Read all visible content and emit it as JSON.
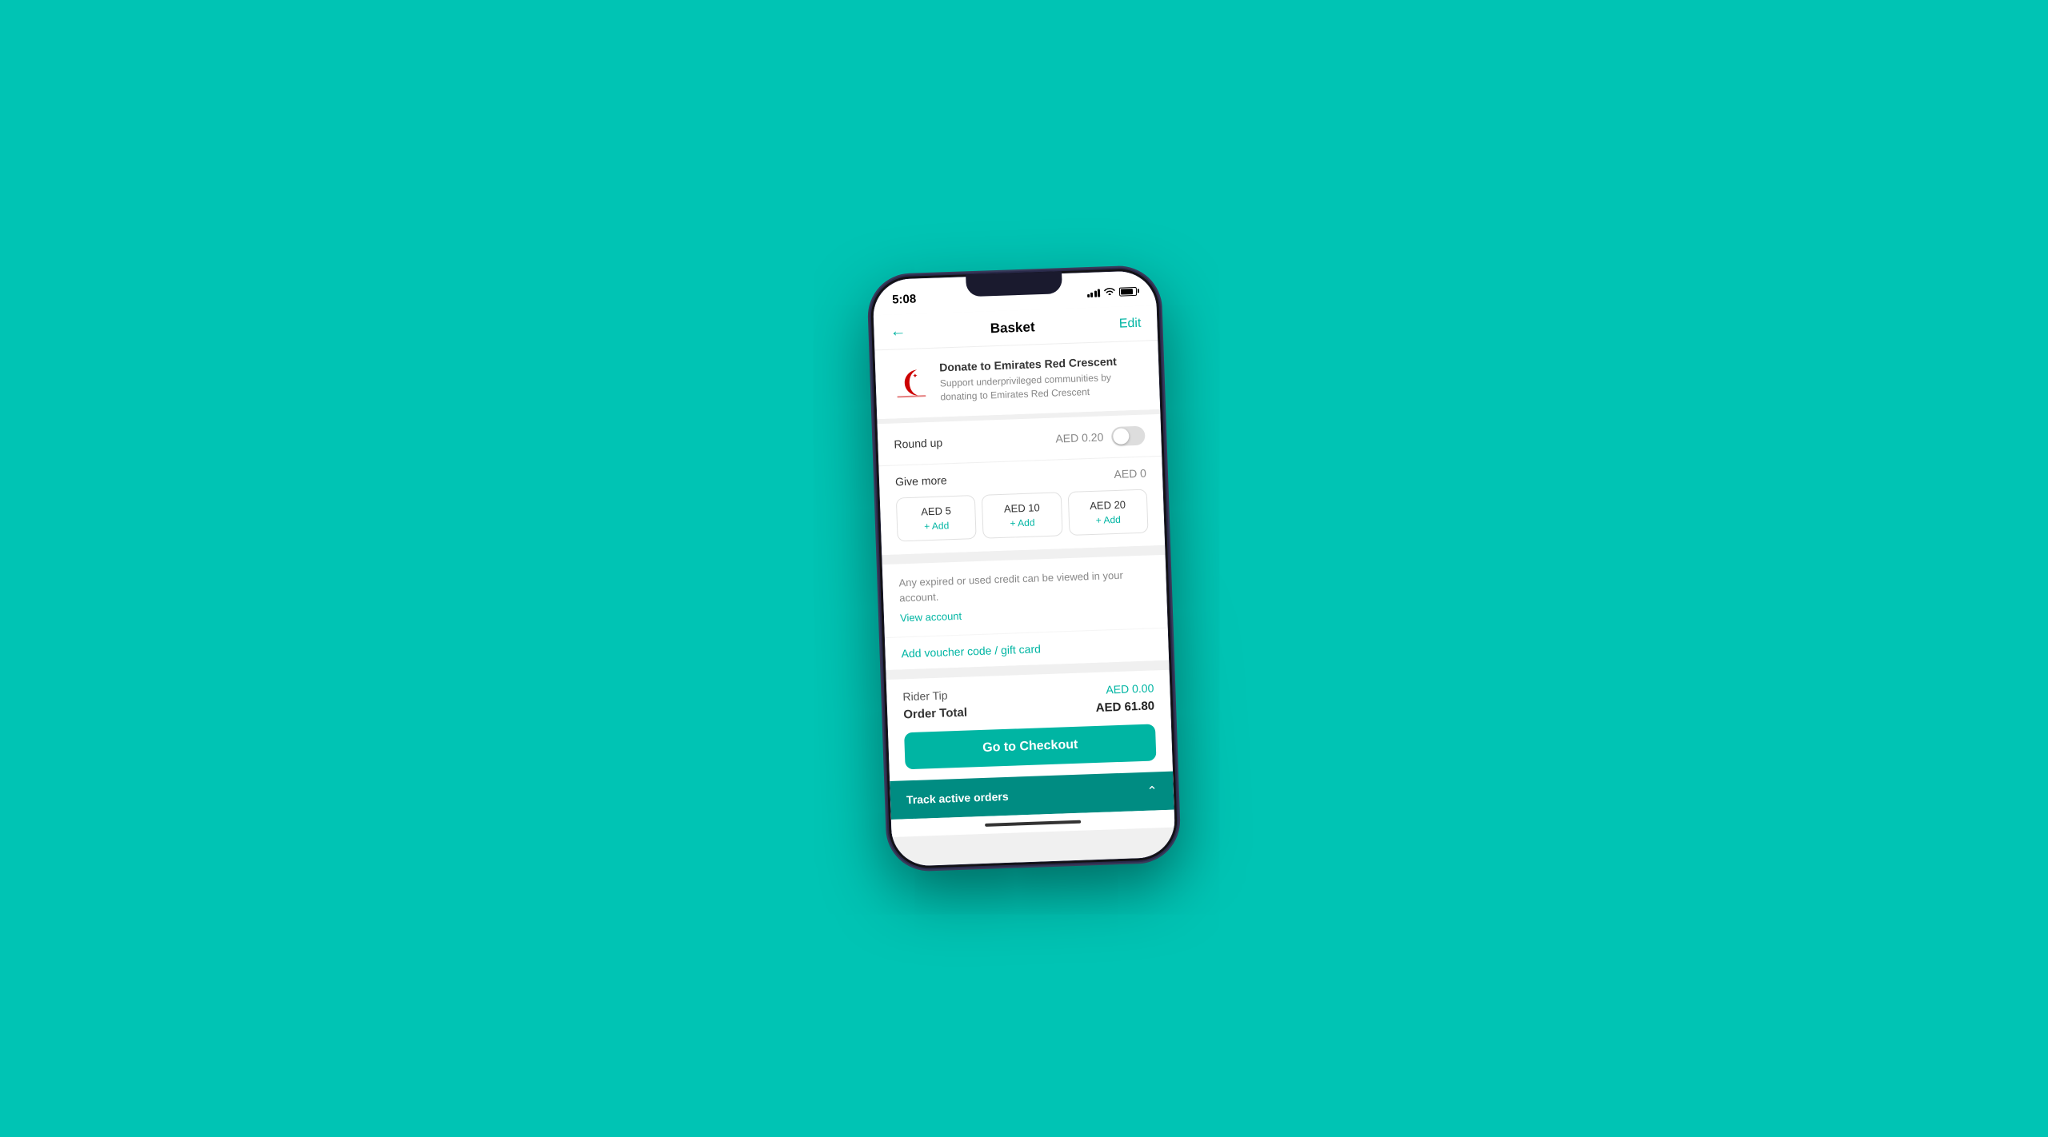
{
  "background": {
    "color": "#00C4B4"
  },
  "status_bar": {
    "time": "5:08",
    "signal": "4 bars",
    "wifi": true,
    "battery": "high"
  },
  "nav": {
    "title": "Basket",
    "back_icon": "←",
    "edit_label": "Edit"
  },
  "donation": {
    "title": "Donate to Emirates Red Crescent",
    "description": "Support underprivileged communities by donating to Emirates Red Crescent"
  },
  "round_up": {
    "label": "Round up",
    "amount": "AED 0.20",
    "toggle_on": false
  },
  "give_more": {
    "label": "Give more",
    "current_amount": "AED 0",
    "options": [
      {
        "amount": "AED 5",
        "add_label": "+ Add"
      },
      {
        "amount": "AED 10",
        "add_label": "+ Add"
      },
      {
        "amount": "AED 20",
        "add_label": "+ Add"
      }
    ]
  },
  "credit": {
    "text": "Any expired or used credit can be viewed in your account.",
    "view_account_label": "View account",
    "voucher_label": "Add voucher code / gift card"
  },
  "order_summary": {
    "rider_tip_label": "Rider Tip",
    "rider_tip_amount": "AED 0.00",
    "order_total_label": "Order Total",
    "order_total_amount": "AED 61.80"
  },
  "checkout_button": {
    "label": "Go to Checkout"
  },
  "track_orders": {
    "label": "Track active orders",
    "icon": "chevron-up"
  }
}
